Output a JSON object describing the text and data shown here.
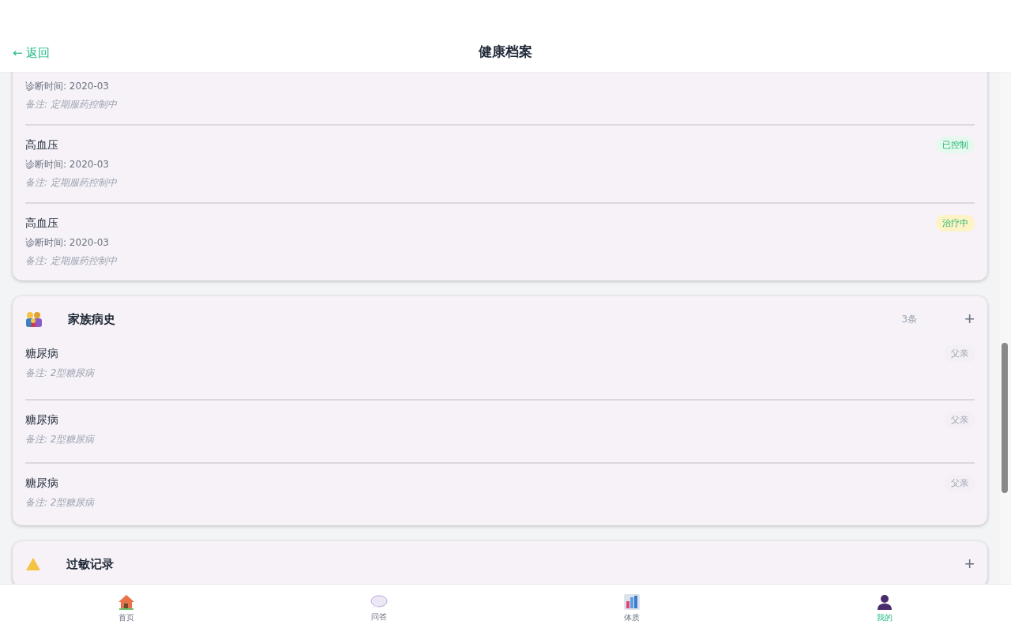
{
  "header": {
    "back": "← 返回",
    "title": "健康档案"
  },
  "sections": [
    {
      "kind": "conditions",
      "items": [
        {
          "diagnosed": "诊断时间: 2020-03",
          "note": "备注: 定期服药控制中"
        },
        {
          "name": "高血压",
          "status": "已控制",
          "kind": "controlled",
          "diagnosed": "诊断时间: 2020-03",
          "note": "备注: 定期服药控制中"
        },
        {
          "name": "高血压",
          "status": "治疗中",
          "kind": "treating",
          "diagnosed": "诊断时间: 2020-03",
          "note": "备注: 定期服药控制中"
        }
      ]
    },
    {
      "kind": "family",
      "title": "家族病史",
      "count": "3条",
      "add": "+",
      "items": [
        {
          "name": "糖尿病",
          "relation": "父亲",
          "note": "备注: 2型糖尿病"
        },
        {
          "name": "糖尿病",
          "relation": "父亲",
          "note": "备注: 2型糖尿病"
        },
        {
          "name": "糖尿病",
          "relation": "父亲",
          "note": "备注: 2型糖尿病"
        }
      ]
    },
    {
      "kind": "allergy",
      "title": "过敏记录",
      "add": "+"
    }
  ],
  "tabs": [
    {
      "label": "首页",
      "kind": "home",
      "selected": false
    },
    {
      "label": "问答",
      "kind": "chat",
      "selected": false
    },
    {
      "label": "体质",
      "kind": "chart",
      "selected": false
    },
    {
      "label": "我的",
      "kind": "me",
      "selected": true
    }
  ]
}
